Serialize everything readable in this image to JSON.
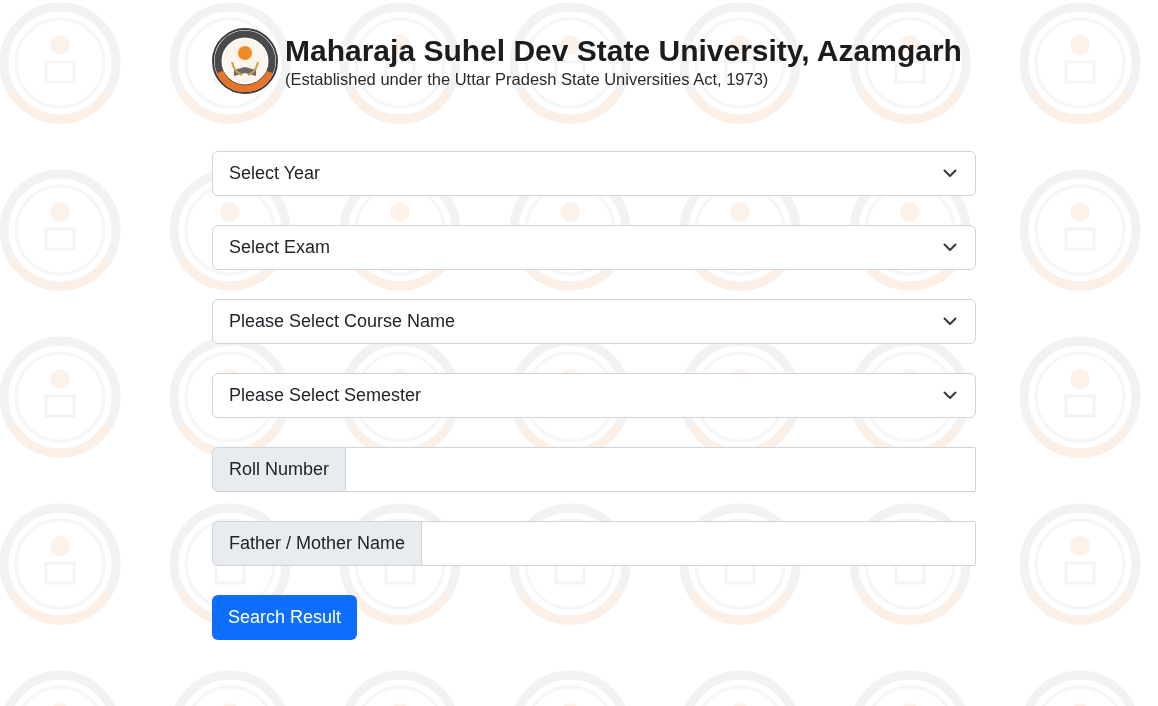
{
  "header": {
    "title": "Maharaja Suhel Dev State University, Azamgarh",
    "subtitle": "(Established under the Uttar Pradesh State Universities Act, 1973)"
  },
  "form": {
    "fields": [
      {
        "kind": "select",
        "placeholder": "Select Year"
      },
      {
        "kind": "select",
        "placeholder": "Select Exam"
      },
      {
        "kind": "select",
        "placeholder": "Please Select Course Name"
      },
      {
        "kind": "select",
        "placeholder": "Please Select Semester"
      },
      {
        "kind": "labeled_input",
        "label": "Roll Number"
      },
      {
        "kind": "labeled_input",
        "label": "Father / Mother Name"
      }
    ],
    "submit_button": "Search Result"
  }
}
